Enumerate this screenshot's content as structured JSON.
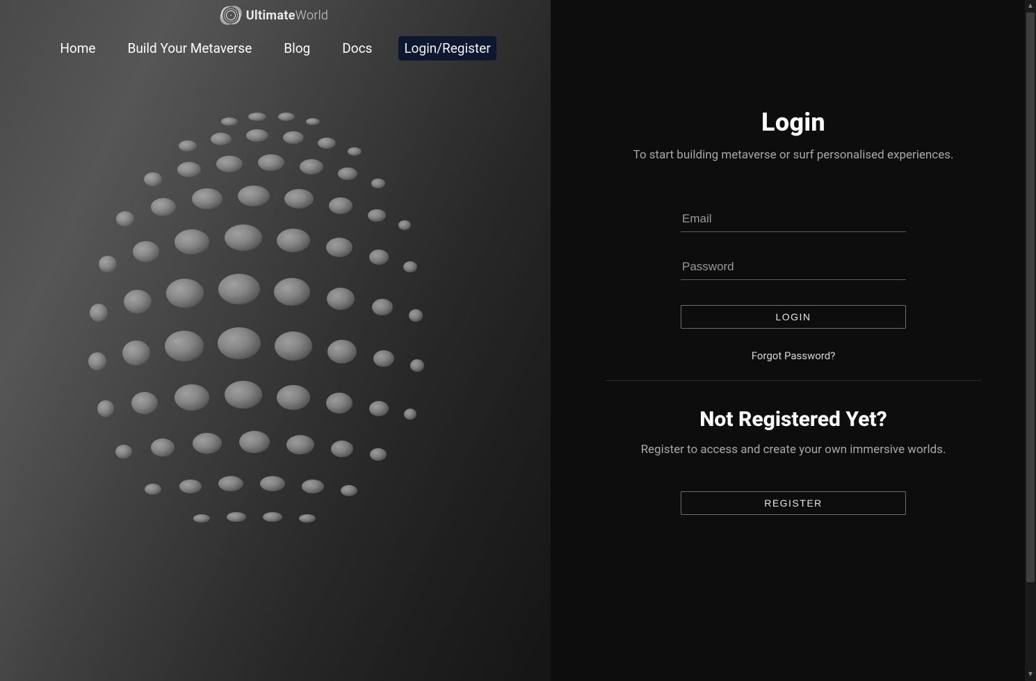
{
  "brand": {
    "bold": "Ultimate",
    "thin": "World"
  },
  "nav": {
    "items": [
      {
        "label": "Home"
      },
      {
        "label": "Build Your Metaverse"
      },
      {
        "label": "Blog"
      },
      {
        "label": "Docs"
      },
      {
        "label": "Login/Register"
      }
    ]
  },
  "login": {
    "title": "Login",
    "subtitle": "To start building metaverse or surf personalised experiences.",
    "email_placeholder": "Email",
    "password_placeholder": "Password",
    "button_label": "LOGIN",
    "forgot_label": "Forgot Password?"
  },
  "register": {
    "title": "Not Registered Yet?",
    "subtitle": "Register to access and create your own immersive worlds.",
    "button_label": "REGISTER"
  }
}
